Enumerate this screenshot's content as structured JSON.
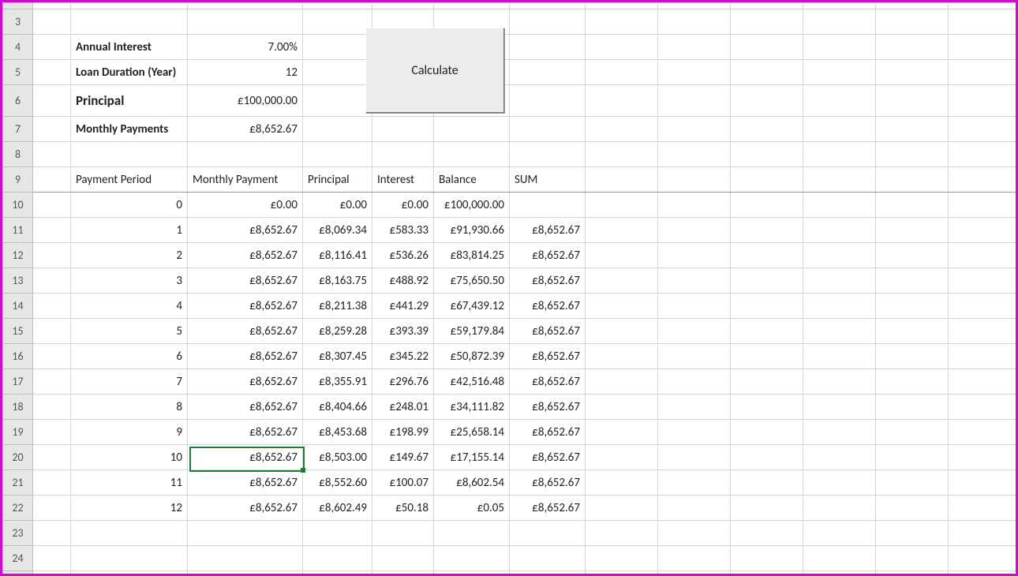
{
  "inputs": {
    "annual_interest_label": "Annual Interest",
    "annual_interest_value": "7.00%",
    "loan_duration_label": "Loan Duration (Year)",
    "loan_duration_value": "12",
    "principal_label": "Principal",
    "principal_value": "£100,000.00",
    "monthly_payments_label": "Monthly Payments",
    "monthly_payments_value": "£8,652.67"
  },
  "button": {
    "calculate": "Calculate"
  },
  "headers": {
    "period": "Payment Period",
    "monthly": "Monthly Payment",
    "principal": "Principal",
    "interest": "Interest",
    "balance": "Balance",
    "sum": "SUM"
  },
  "rownums": {
    "r3": "3",
    "r4": "4",
    "r5": "5",
    "r6": "6",
    "r7": "7",
    "r8": "8",
    "r9": "9",
    "r10": "10",
    "r11": "11",
    "r12": "12",
    "r13": "13",
    "r14": "14",
    "r15": "15",
    "r16": "16",
    "r17": "17",
    "r18": "18",
    "r19": "19",
    "r20": "20",
    "r21": "21",
    "r22": "22",
    "r23": "23",
    "r24": "24"
  },
  "schedule": [
    {
      "period": "0",
      "monthly": "£0.00",
      "principal": "£0.00",
      "interest": "£0.00",
      "balance": "£100,000.00",
      "sum": ""
    },
    {
      "period": "1",
      "monthly": "£8,652.67",
      "principal": "£8,069.34",
      "interest": "£583.33",
      "balance": "£91,930.66",
      "sum": "£8,652.67"
    },
    {
      "period": "2",
      "monthly": "£8,652.67",
      "principal": "£8,116.41",
      "interest": "£536.26",
      "balance": "£83,814.25",
      "sum": "£8,652.67"
    },
    {
      "period": "3",
      "monthly": "£8,652.67",
      "principal": "£8,163.75",
      "interest": "£488.92",
      "balance": "£75,650.50",
      "sum": "£8,652.67"
    },
    {
      "period": "4",
      "monthly": "£8,652.67",
      "principal": "£8,211.38",
      "interest": "£441.29",
      "balance": "£67,439.12",
      "sum": "£8,652.67"
    },
    {
      "period": "5",
      "monthly": "£8,652.67",
      "principal": "£8,259.28",
      "interest": "£393.39",
      "balance": "£59,179.84",
      "sum": "£8,652.67"
    },
    {
      "period": "6",
      "monthly": "£8,652.67",
      "principal": "£8,307.45",
      "interest": "£345.22",
      "balance": "£50,872.39",
      "sum": "£8,652.67"
    },
    {
      "period": "7",
      "monthly": "£8,652.67",
      "principal": "£8,355.91",
      "interest": "£296.76",
      "balance": "£42,516.48",
      "sum": "£8,652.67"
    },
    {
      "period": "8",
      "monthly": "£8,652.67",
      "principal": "£8,404.66",
      "interest": "£248.01",
      "balance": "£34,111.82",
      "sum": "£8,652.67"
    },
    {
      "period": "9",
      "monthly": "£8,652.67",
      "principal": "£8,453.68",
      "interest": "£198.99",
      "balance": "£25,658.14",
      "sum": "£8,652.67"
    },
    {
      "period": "10",
      "monthly": "£8,652.67",
      "principal": "£8,503.00",
      "interest": "£149.67",
      "balance": "£17,155.14",
      "sum": "£8,652.67"
    },
    {
      "period": "11",
      "monthly": "£8,652.67",
      "principal": "£8,552.60",
      "interest": "£100.07",
      "balance": "£8,602.54",
      "sum": "£8,652.67"
    },
    {
      "period": "12",
      "monthly": "£8,652.67",
      "principal": "£8,602.49",
      "interest": "£50.18",
      "balance": "£0.05",
      "sum": "£8,652.67"
    }
  ]
}
